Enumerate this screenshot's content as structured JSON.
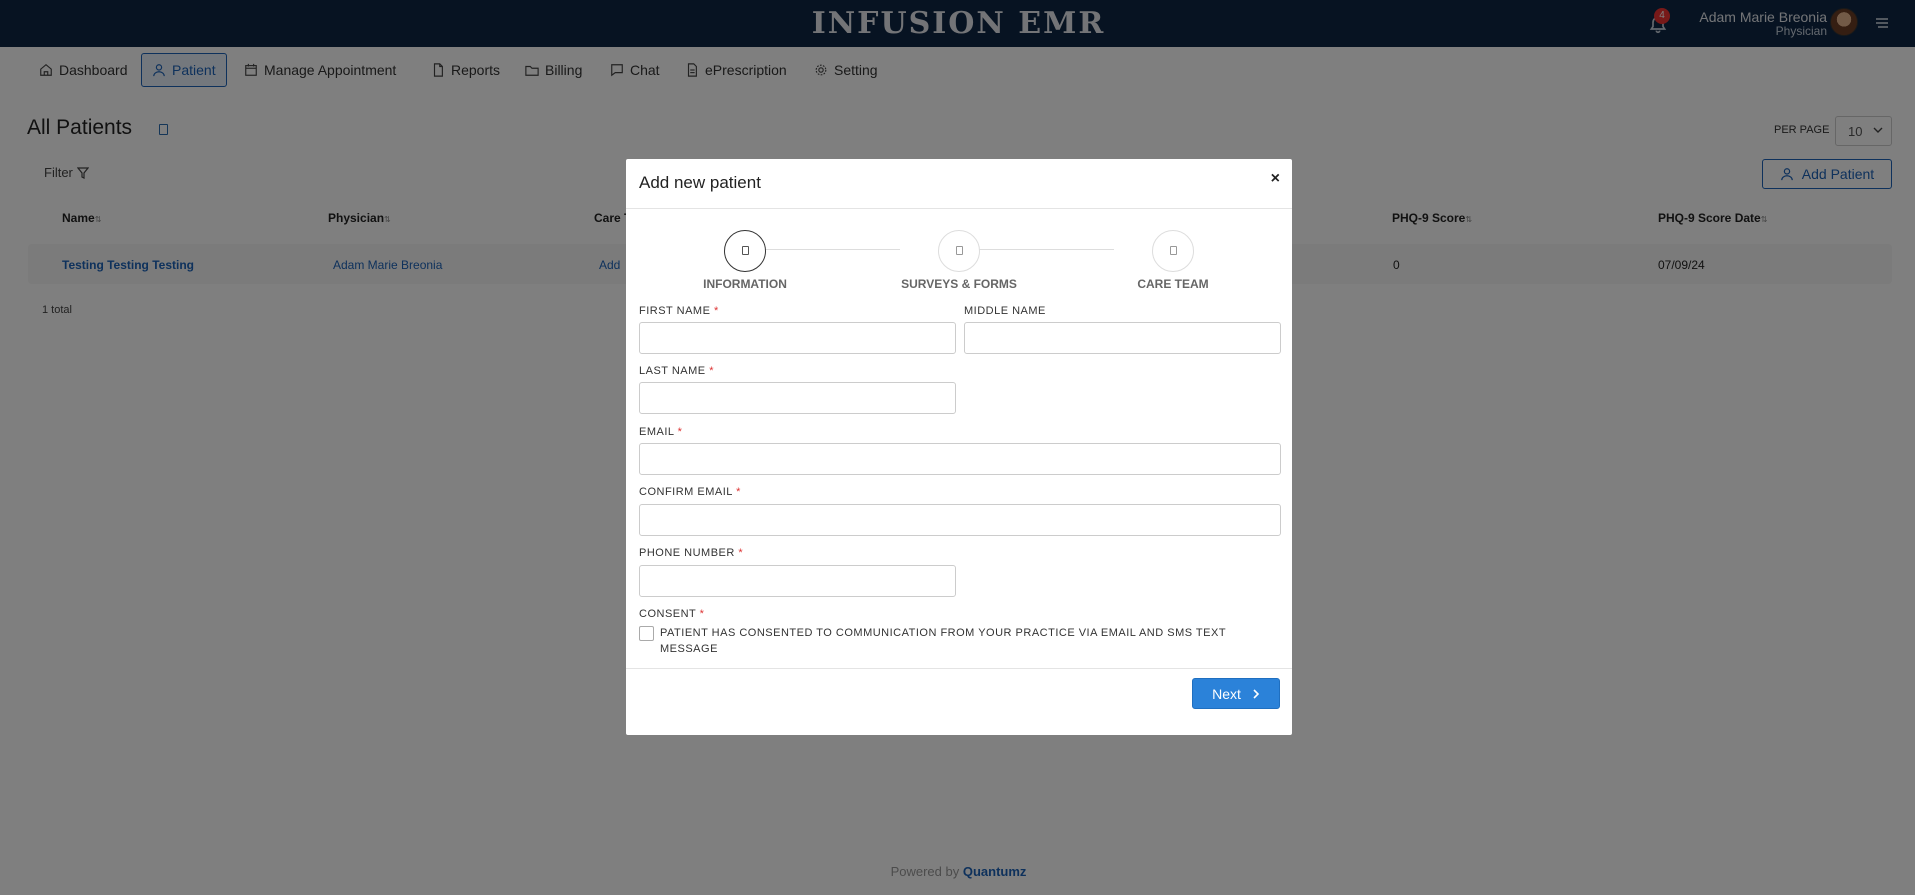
{
  "header": {
    "brand": "INFUSION EMR",
    "notification_count": "4",
    "user_name": "Adam Marie Breonia",
    "user_role": "Physician"
  },
  "nav": {
    "items": [
      {
        "label": "Dashboard",
        "icon": "home-icon"
      },
      {
        "label": "Patient",
        "icon": "user-icon"
      },
      {
        "label": "Manage Appointment",
        "icon": "calendar-icon"
      },
      {
        "label": "Reports",
        "icon": "file-icon"
      },
      {
        "label": "Billing",
        "icon": "folder-icon"
      },
      {
        "label": "Chat",
        "icon": "chat-icon"
      },
      {
        "label": "ePrescription",
        "icon": "prescription-icon"
      },
      {
        "label": "Setting",
        "icon": "gear-icon"
      }
    ],
    "active": "Patient"
  },
  "page": {
    "title": "All Patients",
    "per_page_label": "PER PAGE",
    "per_page_value": "10",
    "filter_label": "Filter",
    "add_patient_label": "Add Patient",
    "total_label": "1 total",
    "powered_by_prefix": "Powered by",
    "powered_by_brand": "Quantumz"
  },
  "table": {
    "columns": [
      "Name",
      "Physician",
      "Care T",
      "PHQ-9 Score",
      "PHQ-9 Score Date"
    ],
    "rows": [
      {
        "name": "Testing Testing Testing",
        "physician": "Adam Marie Breonia",
        "care_team": "Add",
        "phq9_score": "0",
        "phq9_date": "07/09/24"
      }
    ]
  },
  "modal": {
    "title": "Add new patient",
    "close": "×",
    "steps": [
      "INFORMATION",
      "SURVEYS & FORMS",
      "CARE TEAM"
    ],
    "active_step": "INFORMATION",
    "fields": {
      "first_name": "FIRST NAME",
      "middle_name": "MIDDLE NAME",
      "last_name": "LAST NAME",
      "email": "EMAIL",
      "confirm_email": "CONFIRM EMAIL",
      "phone": "PHONE NUMBER",
      "consent": "CONSENT"
    },
    "required_mark": "*",
    "consent_text": "PATIENT HAS CONSENTED TO COMMUNICATION FROM YOUR PRACTICE VIA EMAIL AND SMS TEXT MESSAGE",
    "next_label": "Next"
  },
  "colors": {
    "header_bg": "#0f2744",
    "accent": "#1c63b8",
    "primary_button": "#2b82d9",
    "required": "#dd3333"
  }
}
